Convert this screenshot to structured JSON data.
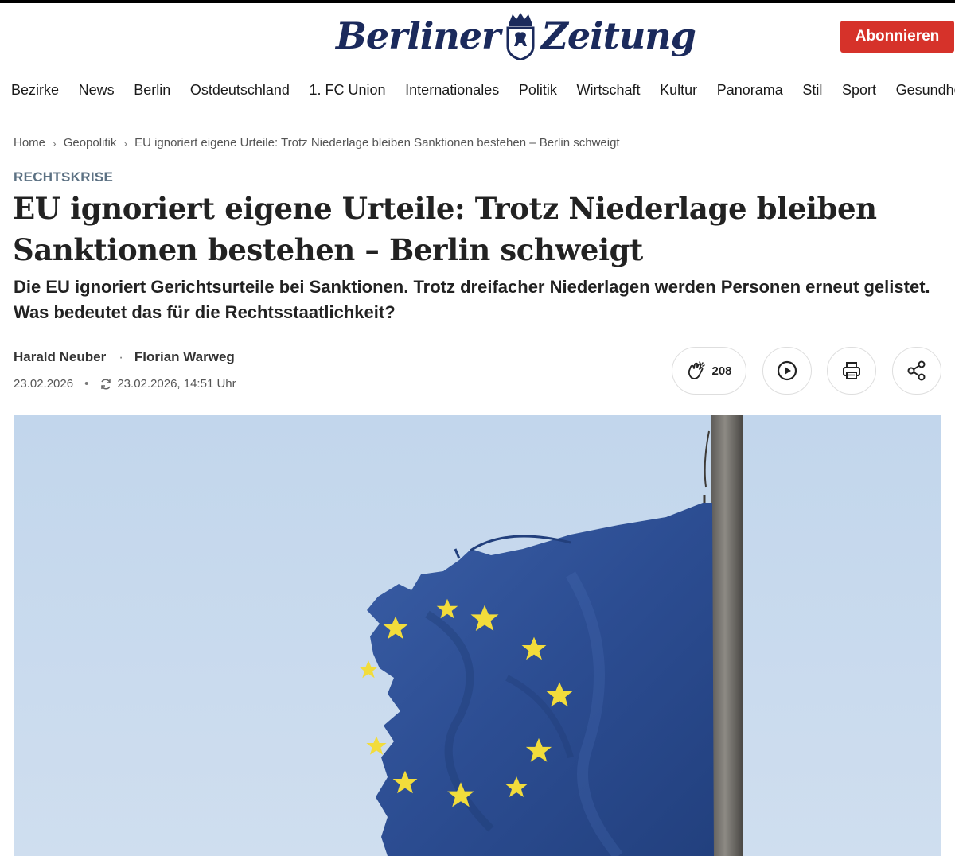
{
  "brand": {
    "name": "Berliner Zeitung",
    "word1": "Berliner",
    "word2": "Zeitung",
    "subscribe_label": "Abonnieren"
  },
  "nav": {
    "items": [
      "Bezirke",
      "News",
      "Berlin",
      "Ostdeutschland",
      "1. FC Union",
      "Internationales",
      "Politik",
      "Wirtschaft",
      "Kultur",
      "Panorama",
      "Stil",
      "Sport",
      "Gesundheit"
    ]
  },
  "breadcrumb": {
    "home": "Home",
    "section": "Geopolitik",
    "current": "EU ignoriert eigene Urteile: Trotz Niederlage bleiben Sanktionen bestehen – Berlin schweigt"
  },
  "article": {
    "kicker": "RECHTSKRISE",
    "headline": "EU ignoriert eigene Urteile: Trotz Niederlage bleiben Sanktionen bestehen – Berlin schweigt",
    "teaser": "Die EU ignoriert Gerichtsurteile bei Sanktionen. Trotz dreifacher Niederlagen werden Personen erneut gelistet. Was bedeutet das für die Rechtsstaatlichkeit?",
    "author1": "Harald Neuber",
    "author2": "Florian Warweg",
    "published": "23.02.2026",
    "updated": "23.02.2026, 14:51 Uhr"
  },
  "actions": {
    "clap_count": "208",
    "icons": [
      "clap-icon",
      "play-icon",
      "print-icon",
      "share-icon"
    ]
  },
  "colors": {
    "accent": "#d6322a",
    "brand_blue": "#1b2a5c",
    "kicker": "#5c7183",
    "eu_blue": "#2e4f93",
    "eu_star": "#f2dc3b",
    "sky": "#c6d8ec"
  }
}
